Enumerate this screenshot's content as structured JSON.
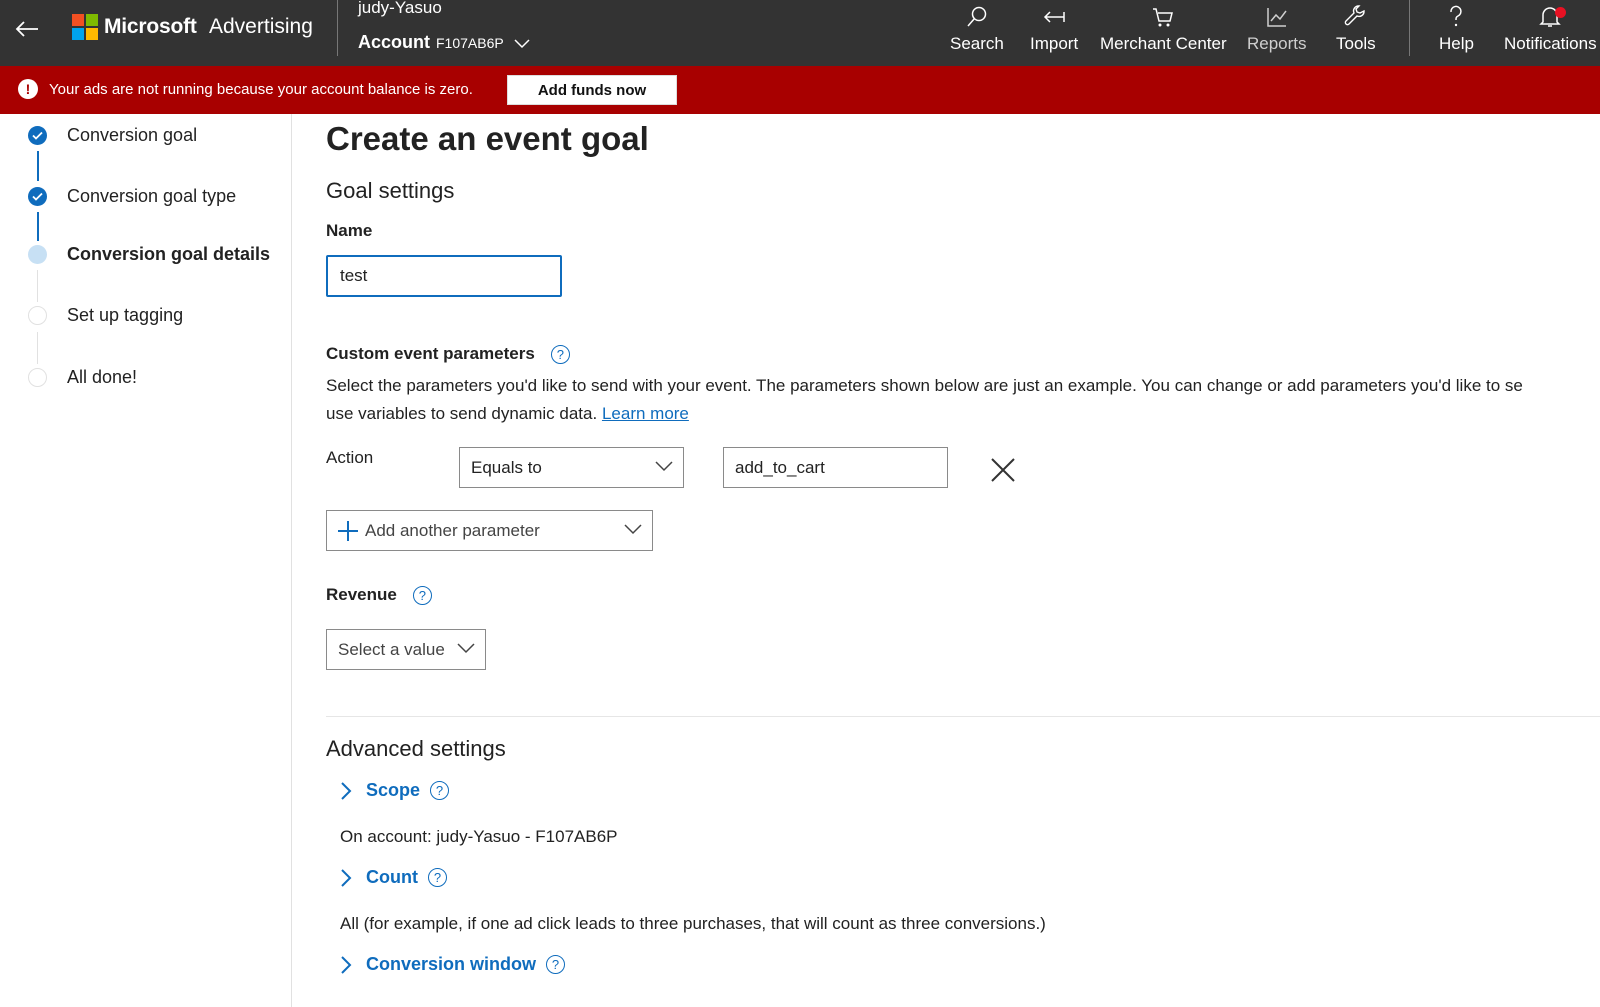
{
  "topbar": {
    "brand_microsoft": "Microsoft",
    "brand_advertising": "Advertising",
    "account_user": "judy-Yasuo",
    "account_label": "Account",
    "account_id": "F107AB6P",
    "nav": [
      {
        "label": "Search",
        "icon": "search-icon"
      },
      {
        "label": "Import",
        "icon": "import-icon"
      },
      {
        "label": "Merchant Center",
        "icon": "cart-icon"
      },
      {
        "label": "Reports",
        "icon": "chart-icon"
      },
      {
        "label": "Tools",
        "icon": "wrench-icon"
      },
      {
        "label": "Help",
        "icon": "question-icon"
      },
      {
        "label": "Notifications",
        "icon": "bell-icon"
      }
    ]
  },
  "banner": {
    "message": "Your ads are not running because your account balance is zero.",
    "button": "Add funds now"
  },
  "stepper": {
    "steps": [
      {
        "label": "Conversion goal",
        "state": "done"
      },
      {
        "label": "Conversion goal type",
        "state": "done"
      },
      {
        "label": "Conversion goal details",
        "state": "current"
      },
      {
        "label": "Set up tagging",
        "state": "todo"
      },
      {
        "label": "All done!",
        "state": "todo"
      }
    ]
  },
  "main": {
    "title": "Create an event goal",
    "goal_settings": "Goal settings",
    "name_label": "Name",
    "name_value": "test",
    "custom_params_label": "Custom event parameters",
    "custom_params_desc_1": "Select the parameters you'd like to send with your event. The parameters shown below are just an example. You can change or add parameters you'd like to se",
    "custom_params_desc_2": "use variables to send dynamic data.",
    "learn_more": "Learn more",
    "action_label": "Action",
    "action_operator": "Equals to",
    "action_value": "add_to_cart",
    "add_param": "Add another parameter",
    "revenue_label": "Revenue",
    "revenue_select": "Select a value",
    "advanced_settings": "Advanced settings",
    "scope_label": "Scope",
    "scope_value": "On account: judy-Yasuo - F107AB6P",
    "count_label": "Count",
    "count_value": "All (for example, if one ad click leads to three purchases, that will count as three conversions.)",
    "window_label": "Conversion window"
  },
  "colors": {
    "topbar": "#333333",
    "banner": "#a80000",
    "accent": "#0f6cbd",
    "current_step": "#c7e0f4"
  }
}
